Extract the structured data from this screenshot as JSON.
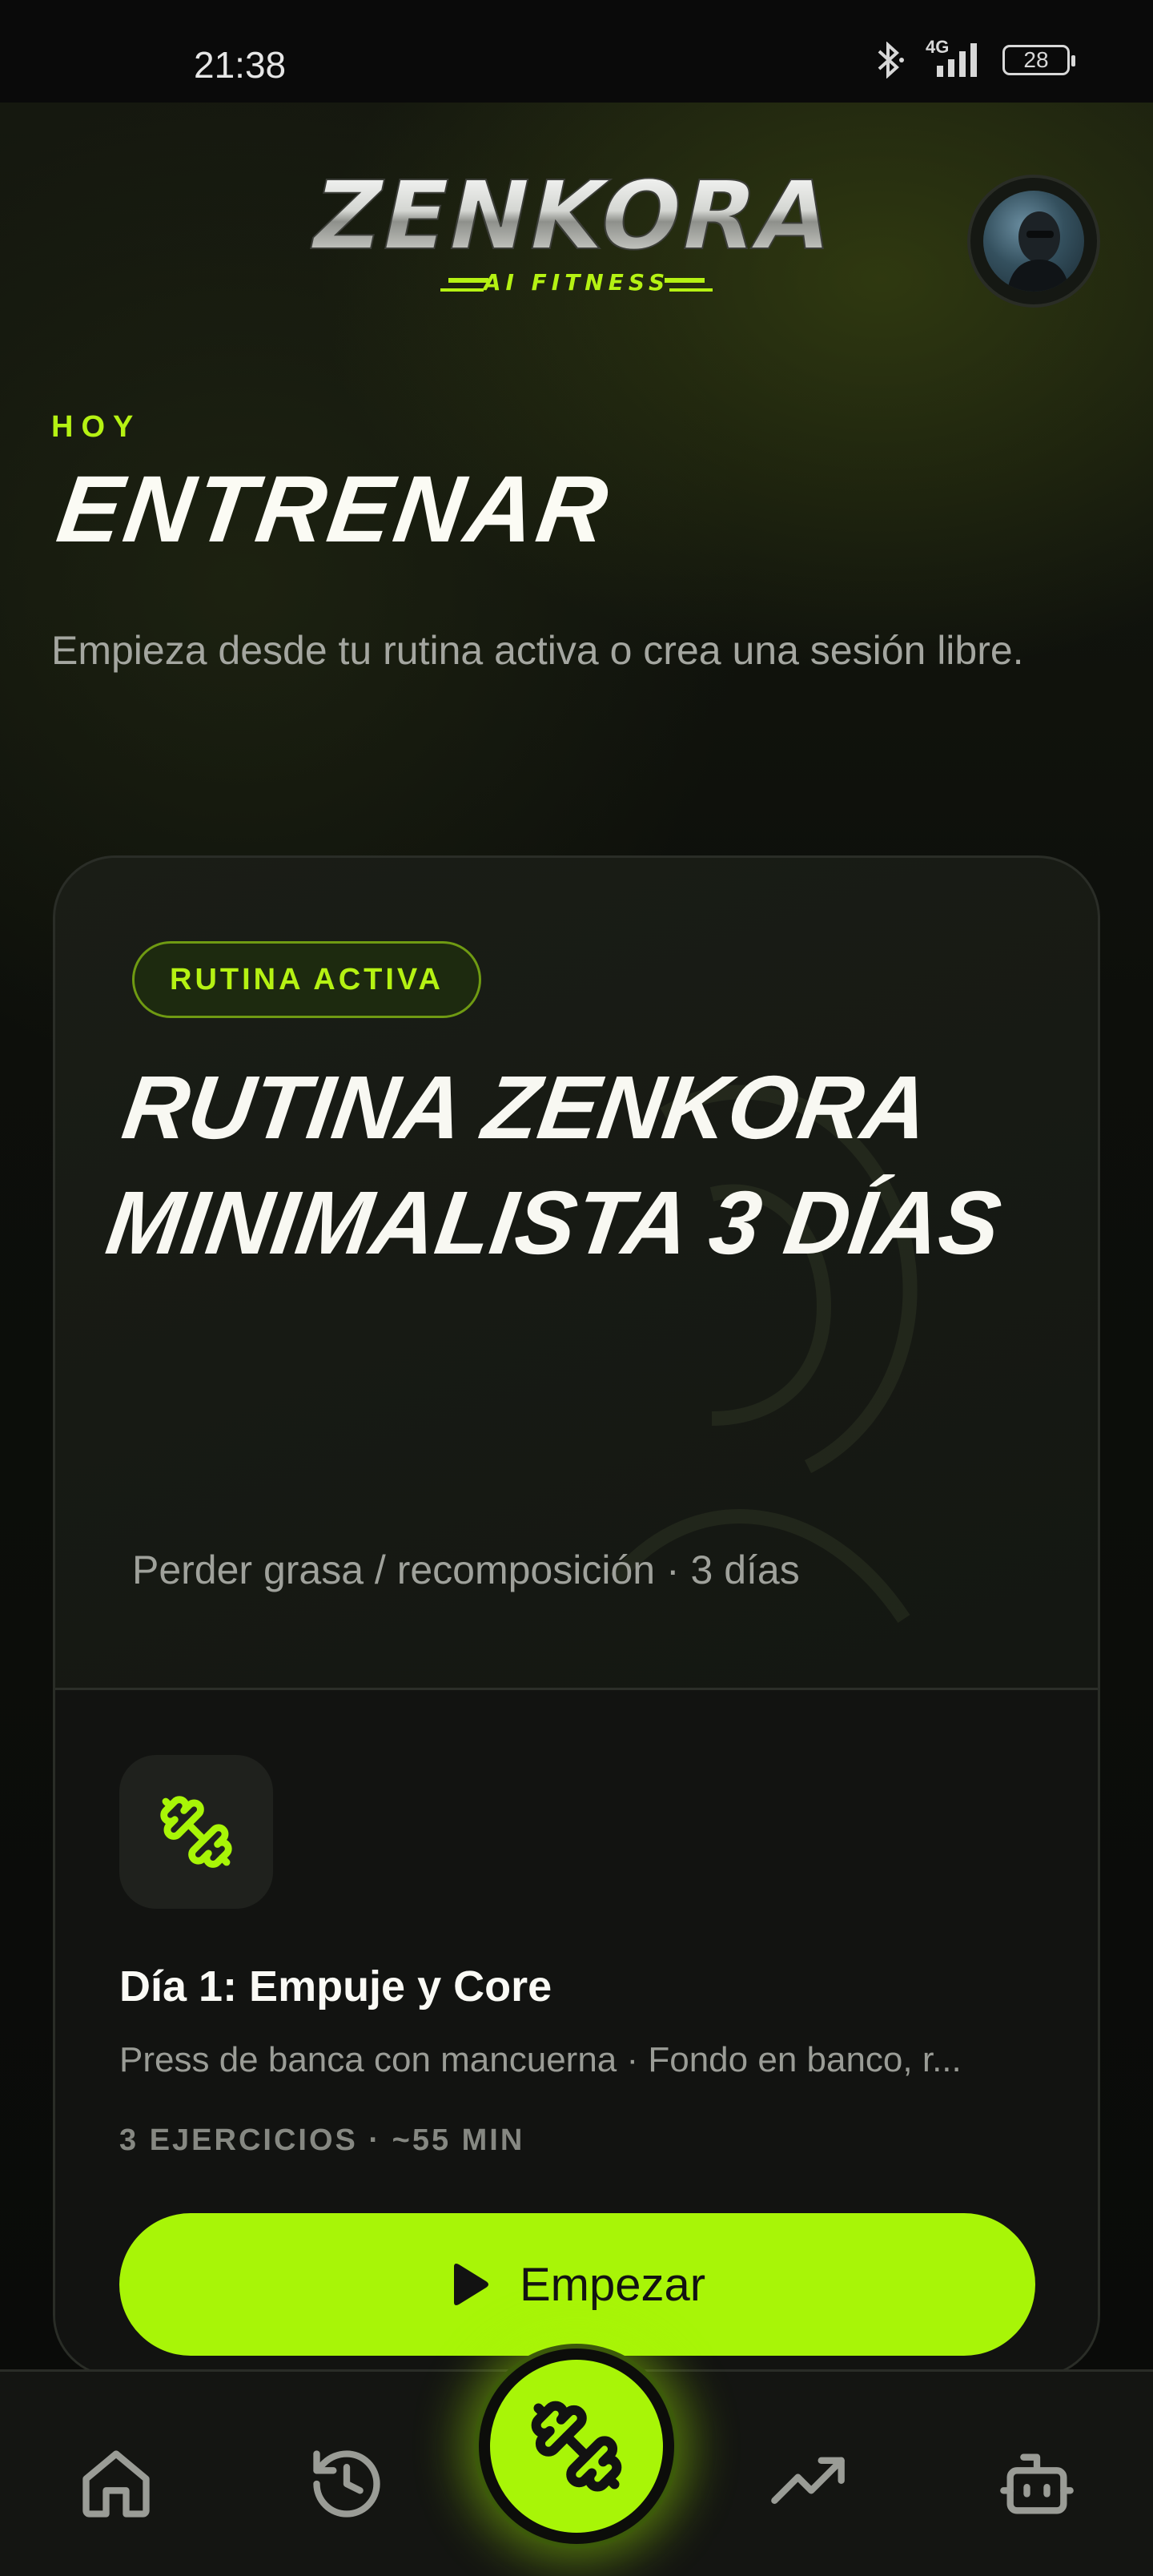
{
  "status_bar": {
    "time": "21:38",
    "network": "4G",
    "battery": "28"
  },
  "brand": {
    "logo_text": "ZENKORA",
    "logo_subtext": "AI FITNESS",
    "accent_color": "#a8f507"
  },
  "header": {
    "eyebrow": "HOY",
    "title": "ENTRENAR",
    "subtitle": "Empieza desde tu rutina activa o crea una sesión libre."
  },
  "active_routine": {
    "badge": "RUTINA ACTIVA",
    "title": "RUTINA ZENKORA MINIMALISTA 3 DÍAS",
    "meta": "Perder grasa / recomposición · 3 días",
    "day": {
      "icon": "dumbbell-icon",
      "title": "Día 1: Empuje y Core",
      "exercises": "Press de banca con mancuerna · Fondo en banco, r...",
      "summary": "3 EJERCICIOS · ~55 MIN"
    },
    "start_button": "Empezar"
  },
  "bottom_nav": {
    "items": [
      {
        "icon": "home-icon"
      },
      {
        "icon": "history-icon"
      },
      {
        "icon": "dumbbell-icon",
        "active": true
      },
      {
        "icon": "trending-up-icon"
      },
      {
        "icon": "robot-icon"
      }
    ]
  }
}
